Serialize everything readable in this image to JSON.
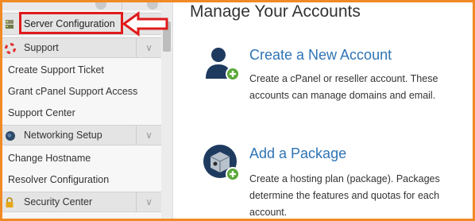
{
  "sidebar": {
    "categories": {
      "server_configuration": {
        "label": "Server Configuration",
        "icon": "server-icon"
      },
      "support": {
        "label": "Support",
        "icon": "lifebuoy-icon"
      },
      "networking_setup": {
        "label": "Networking Setup",
        "icon": "globe-icon"
      },
      "security_center": {
        "label": "Security Center",
        "icon": "lock-icon"
      }
    },
    "support_items": [
      "Create Support Ticket",
      "Grant cPanel Support Access",
      "Support Center"
    ],
    "networking_items": [
      "Change Hostname",
      "Resolver Configuration"
    ]
  },
  "annotation": {
    "color": "#e01b1b"
  },
  "main": {
    "title": "Manage Your Accounts",
    "features": [
      {
        "title": "Create a New Account",
        "description": "Create a cPanel or reseller account. These accounts can manage domains and email.",
        "icon": "user-add-icon"
      },
      {
        "title": "Add a Package",
        "description": "Create a hosting plan (package). Packages determine the features and quotas for each account.",
        "icon": "package-add-icon"
      }
    ]
  },
  "colors": {
    "frame": "#f08a24",
    "link": "#2e74b5",
    "add_badge": "#5aa838",
    "icon_navy": "#1e3a5f"
  }
}
